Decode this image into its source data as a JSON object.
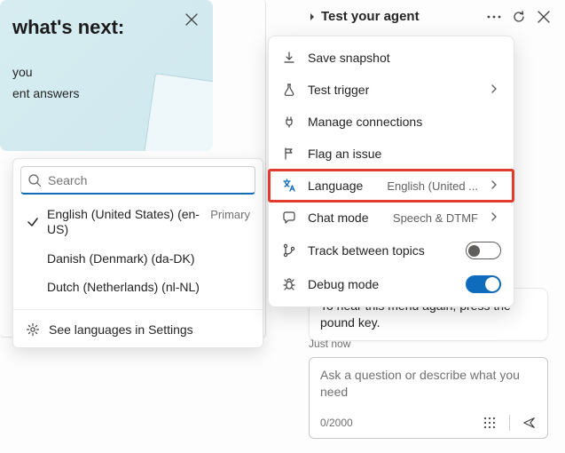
{
  "hero": {
    "title": " what's next:",
    "line1": "you",
    "line2": "ent answers"
  },
  "langPopup": {
    "searchPlaceholder": "Search",
    "items": [
      {
        "label": "English (United States) (en-US)",
        "badge": "Primary",
        "selected": true
      },
      {
        "label": "Danish (Denmark) (da-DK)",
        "badge": "",
        "selected": false
      },
      {
        "label": "Dutch (Netherlands) (nl-NL)",
        "badge": "",
        "selected": false
      }
    ],
    "footer": "See languages in Settings"
  },
  "rightHeader": {
    "title": "Test your agent"
  },
  "menu": {
    "save": "Save snapshot",
    "trigger": "Test trigger",
    "connections": "Manage connections",
    "flag": "Flag an issue",
    "language": {
      "label": "Language",
      "value": "English (United ..."
    },
    "chatmode": {
      "label": "Chat mode",
      "value": "Speech & DTMF"
    },
    "track": "Track between topics",
    "debug": "Debug mode"
  },
  "chat": {
    "bubble": "To hear this menu again, press the pound key.",
    "timestamp": "Just now",
    "composerPlaceholder": "Ask a question or describe what you need",
    "counter": "0/2000"
  }
}
